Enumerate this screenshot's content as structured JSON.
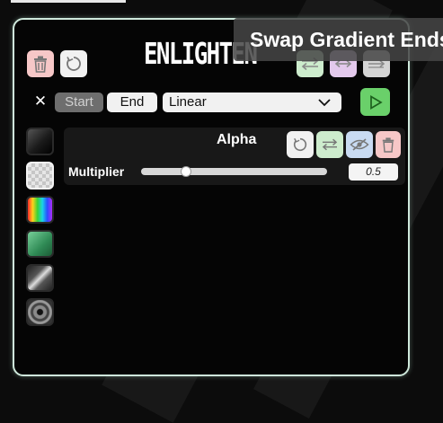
{
  "app": {
    "title": "ENLIGHTEN"
  },
  "tooltip": {
    "text": "Swap Gradient Ends"
  },
  "toolbar": {
    "delete_icon": "trash-icon",
    "reset_icon": "refresh-icon",
    "swap_icon": "swap-arrows-icon",
    "stretch_icon": "double-arrow-icon",
    "shift_icon": "right-arrow-icon"
  },
  "stops": {
    "close_icon": "close-icon",
    "start_label": "Start",
    "end_label": "End"
  },
  "interpolation": {
    "selected": "Linear"
  },
  "presets": [
    {
      "name": "black-fade"
    },
    {
      "name": "checker-transparent"
    },
    {
      "name": "rainbow"
    },
    {
      "name": "green-fade"
    },
    {
      "name": "diagonal-stripe"
    },
    {
      "name": "radial"
    }
  ],
  "properties": {
    "section_title": "Alpha",
    "multiplier_label": "Multiplier",
    "multiplier_value": "0.5",
    "multiplier_fraction": 0.24
  }
}
